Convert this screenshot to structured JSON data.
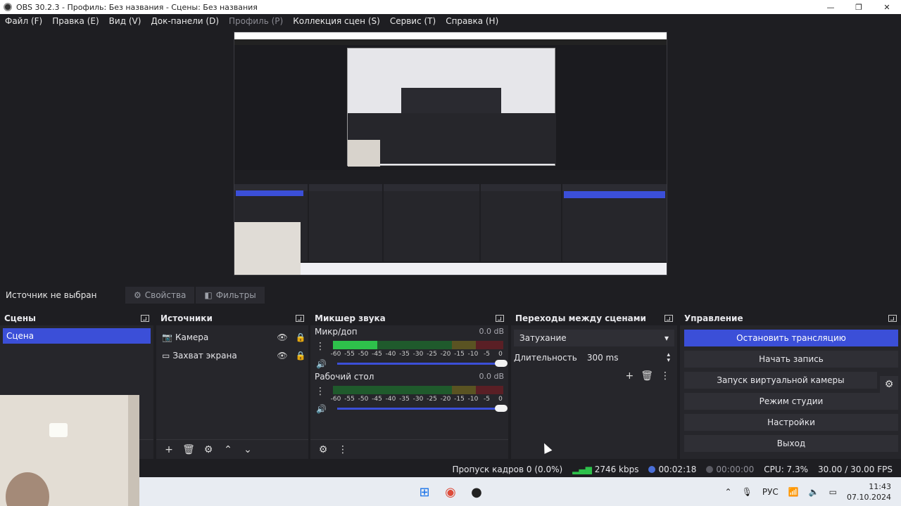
{
  "window": {
    "title": "OBS 30.2.3 - Профиль: Без названия - Сцены: Без названия",
    "minimize": "—",
    "maximize": "❐",
    "close": "✕"
  },
  "menu": [
    {
      "label": "Файл (F)"
    },
    {
      "label": "Правка (E)"
    },
    {
      "label": "Вид (V)"
    },
    {
      "label": "Док-панели (D)"
    },
    {
      "label": "Профиль (P)"
    },
    {
      "label": "Коллекция сцен (S)"
    },
    {
      "label": "Сервис (T)"
    },
    {
      "label": "Справка (H)"
    }
  ],
  "infobar": {
    "no_source": "Источник не выбран",
    "properties": "Свойства",
    "filters": "Фильтры",
    "properties_icon": "gear-icon",
    "filters_icon": "filter-icon"
  },
  "scenes": {
    "title": "Сцены",
    "items": [
      {
        "label": "Сцена"
      }
    ]
  },
  "sources": {
    "title": "Источники",
    "items": [
      {
        "label": "Камера",
        "icon": "camera-icon"
      },
      {
        "label": "Захват экрана",
        "icon": "monitor-icon"
      }
    ]
  },
  "mixer": {
    "title": "Микшер звука",
    "channels": [
      {
        "name": "Микр/доп",
        "db": "0.0 dB",
        "level": 0.26
      },
      {
        "name": "Рабочий стол",
        "db": "0.0 dB",
        "level": 0
      }
    ],
    "ticks": [
      "-60",
      "-55",
      "-50",
      "-45",
      "-40",
      "-35",
      "-30",
      "-25",
      "-20",
      "-15",
      "-10",
      "-5",
      "0"
    ]
  },
  "transitions": {
    "title": "Переходы между сценами",
    "selected": "Затухание",
    "duration_label": "Длительность",
    "duration_value": "300 ms"
  },
  "controls": {
    "title": "Управление",
    "stop_stream": "Остановить трансляцию",
    "start_record": "Начать запись",
    "virtual_cam": "Запуск виртуальной камеры",
    "studio_mode": "Режим студии",
    "settings": "Настройки",
    "exit": "Выход"
  },
  "status": {
    "dropped": "Пропуск кадров 0 (0.0%)",
    "bitrate": "2746 kbps",
    "stream_time": "00:02:18",
    "record_time": "00:00:00",
    "cpu": "CPU: 7.3%",
    "fps": "30.00 / 30.00 FPS"
  },
  "taskbar": {
    "lang": "РУС",
    "time": "11:43",
    "date": "07.10.2024"
  },
  "colors": {
    "accent": "#3b4fd8",
    "panel": "#26262b",
    "background": "#1e1e22",
    "meter_green": "#2ec14b",
    "meter_yellow": "#c7b23a",
    "meter_red": "#b8343e"
  }
}
